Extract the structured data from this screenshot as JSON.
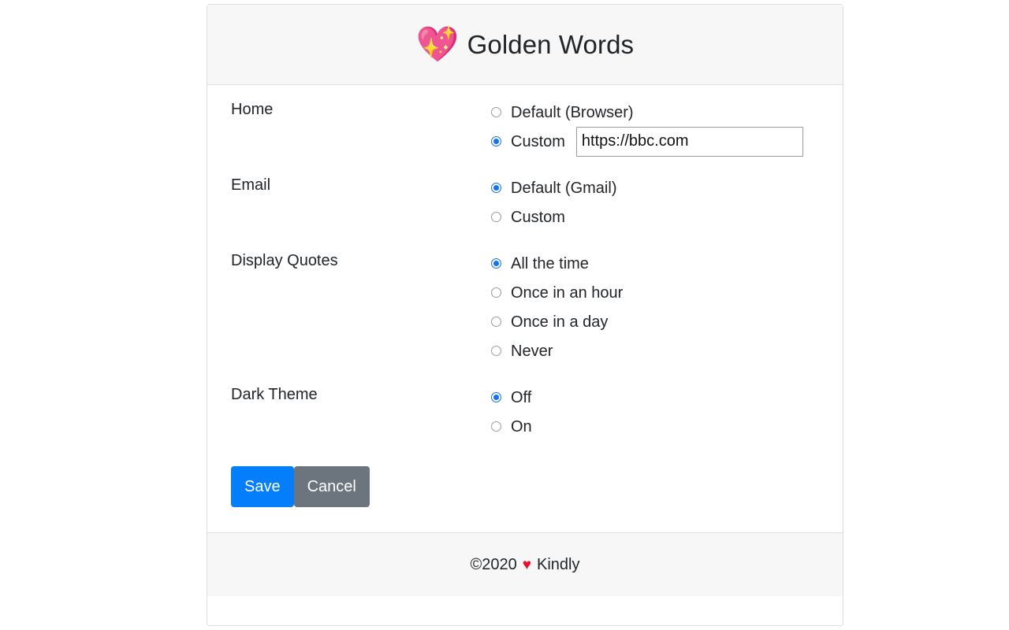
{
  "header": {
    "logo_icon": "sparkling-heart-emoji",
    "logo_glyph": "💖",
    "title": "Golden Words"
  },
  "form": {
    "rows": [
      {
        "label": "Home",
        "options": [
          {
            "label": "Default (Browser)",
            "checked": false
          },
          {
            "label": "Custom",
            "checked": true
          }
        ],
        "input": {
          "value": "https://bbc.com",
          "placeholder": ""
        }
      },
      {
        "label": "Email",
        "options": [
          {
            "label": "Default (Gmail)",
            "checked": true
          },
          {
            "label": "Custom",
            "checked": false
          }
        ]
      },
      {
        "label": "Display Quotes",
        "options": [
          {
            "label": "All the time",
            "checked": true
          },
          {
            "label": "Once in an hour",
            "checked": false
          },
          {
            "label": "Once in a day",
            "checked": false
          },
          {
            "label": "Never",
            "checked": false
          }
        ]
      },
      {
        "label": "Dark Theme",
        "options": [
          {
            "label": "Off",
            "checked": true
          },
          {
            "label": "On",
            "checked": false
          }
        ]
      }
    ]
  },
  "buttons": {
    "save_label": "Save",
    "cancel_label": "Cancel",
    "save_color": "#057efc",
    "cancel_color": "#6c757d"
  },
  "footer": {
    "copyright": "©2020",
    "heart_icon": "heart-icon",
    "heart_glyph": "♥",
    "credit": "Kindly"
  },
  "colors": {
    "accent": "#1273ea",
    "panel_bg": "#f7f7f7",
    "border": "#dededf",
    "text": "#212529",
    "heart_red": "#e8112d"
  }
}
